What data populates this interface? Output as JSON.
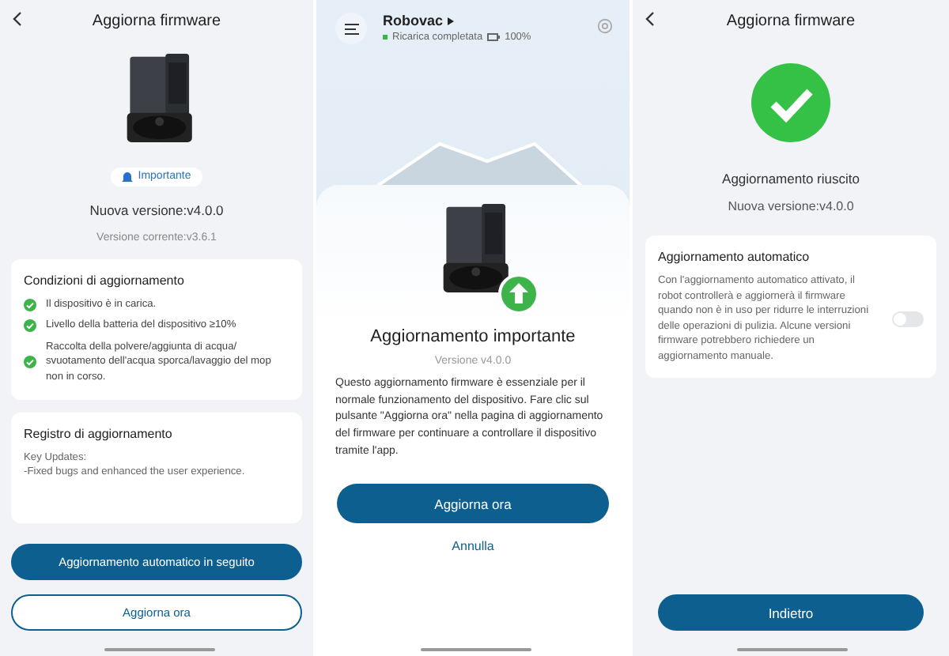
{
  "update_screen": {
    "title": "Aggiorna firmware",
    "badge": "Importante",
    "new_version": "Nuova versione:v4.0.0",
    "current_version": "Versione corrente:v3.6.1",
    "conditions": {
      "title": "Condizioni di aggiornamento",
      "items": [
        {
          "text": "Il dispositivo è in carica.",
          "checked": true
        },
        {
          "text": "Livello della batteria del dispositivo ≥10%",
          "checked": true
        },
        {
          "text": "Raccolta della polvere/aggiunta di acqua/ svuotamento dell'acqua sporca/lavaggio del mop non in corso.",
          "checked": true
        }
      ]
    },
    "log": {
      "title": "Registro di aggiornamento",
      "lines": [
        "Key Updates:",
        "-Fixed bugs and enhanced the user experience."
      ]
    },
    "buttons": [
      {
        "label": "Aggiornamento automatico in seguito",
        "kind": "primary"
      },
      {
        "label": "Aggiorna ora",
        "kind": "outline"
      }
    ]
  },
  "dialog_screen": {
    "device_name": "Robovac",
    "status": "Ricarica completata",
    "battery": "100%",
    "dialog": {
      "title": "Aggiornamento importante",
      "version": "Versione v4.0.0",
      "message": "Questo aggiornamento firmware è essenziale per il normale funzionamento del dispositivo. Fare clic sul pulsante \"Aggiorna ora\" nella pagina di aggiornamento del firmware per continuare a controllare il dispositivo tramite l'app.",
      "confirm": "Aggiorna ora",
      "cancel": "Annulla"
    }
  },
  "success_screen": {
    "title": "Aggiorna firmware",
    "result": "Aggiornamento riuscito",
    "new_version": "Nuova versione:v4.0.0",
    "auto_update": {
      "title": "Aggiornamento automatico",
      "description": "Con l'aggiornamento automatico attivato, il robot controllerà e aggiornerà il firmware quando non è in uso per ridurre le interruzioni delle operazioni di pulizia. Alcune versioni firmware potrebbero richiedere un aggiornamento manuale.",
      "on": false
    },
    "button": "Indietro"
  }
}
